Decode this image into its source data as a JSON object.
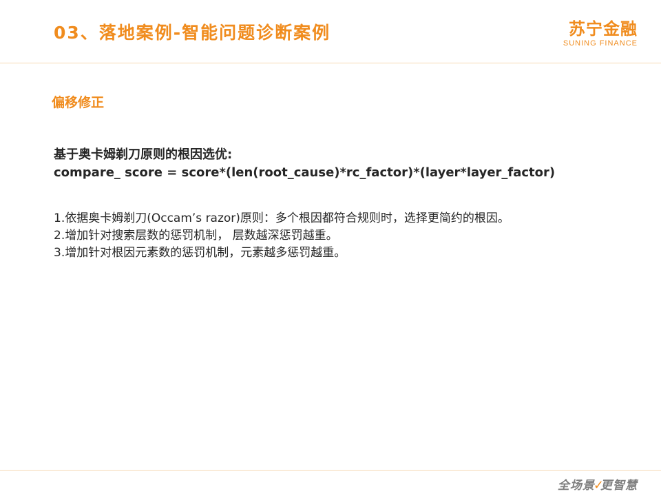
{
  "header": {
    "title": "03、落地案例-智能问题诊断案例",
    "brand_cn": "苏宁金融",
    "brand_en": "SUNING FINANCE"
  },
  "section": {
    "heading": "偏移修正"
  },
  "formula": {
    "title": "基于奥卡姆剃刀原则的根因选优:",
    "expression": "compare_ score = score*(len(root_cause)*rc_factor)*(layer*layer_factor)"
  },
  "rules": [
    "1.依据奥卡姆剃刀(Occam’s razor)原则：多个根因都符合规则时，选择更简约的根因。",
    "2.增加针对搜索层数的惩罚机制， 层数越深惩罚越重。",
    "3.增加针对根因元素数的惩罚机制，元素越多惩罚越重。"
  ],
  "footer": {
    "slogan_part1": "全场景",
    "slogan_part2": "更智慧"
  },
  "colors": {
    "accent": "#f08c1e",
    "text": "#262626",
    "divider": "#f5d9b3",
    "footer_text": "#808080"
  }
}
